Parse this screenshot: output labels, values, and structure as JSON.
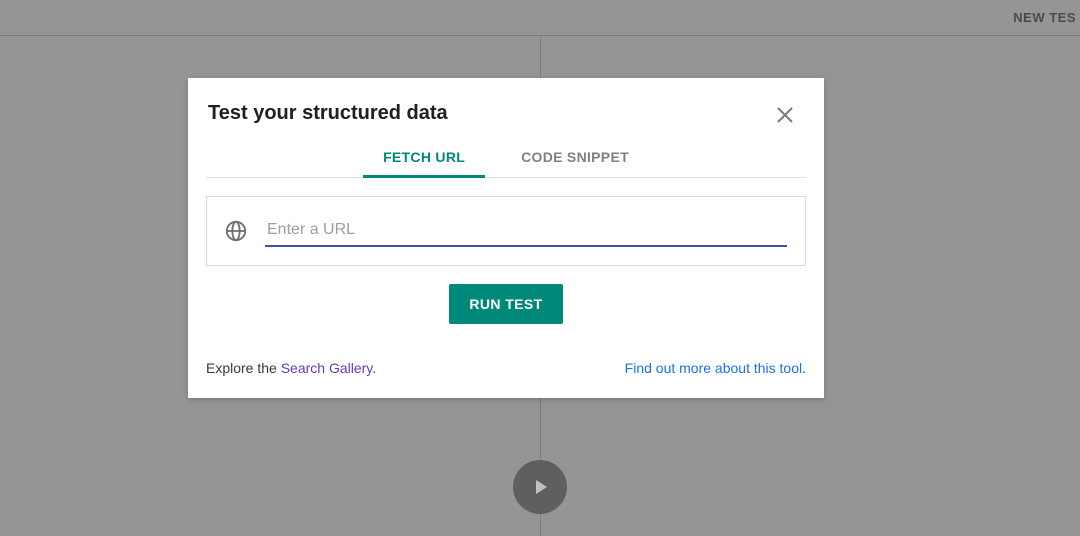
{
  "topbar": {
    "new_test": "NEW TES"
  },
  "modal": {
    "title": "Test your structured data",
    "tabs": {
      "fetch_url": "FETCH URL",
      "code_snippet": "CODE SNIPPET"
    },
    "url_input": {
      "placeholder": "Enter a URL",
      "value": ""
    },
    "run_button": "RUN TEST",
    "footer": {
      "explore_prefix": "Explore the ",
      "search_gallery": "Search Gallery",
      "explore_suffix": ".",
      "learn_more": "Find out more about this tool",
      "learn_more_suffix": "."
    }
  }
}
